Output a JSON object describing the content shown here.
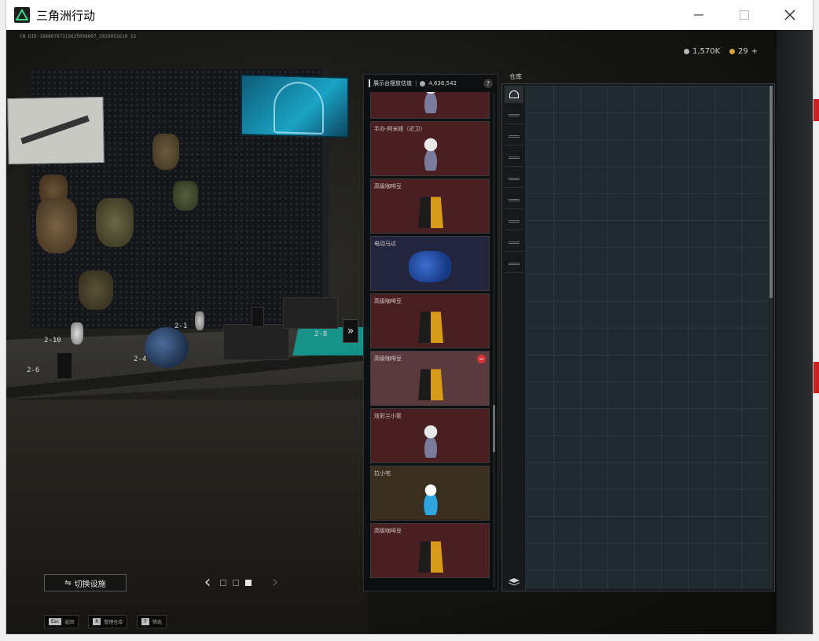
{
  "window": {
    "title": "三角洲行动",
    "controls": [
      "minimize",
      "maximize",
      "close"
    ]
  },
  "hud": {
    "uid_text": "CN UID:18880787315635098607_2026051610 15",
    "currency_1": "1,570K",
    "currency_2": "29",
    "currency_plus": "+"
  },
  "display_panel": {
    "title": "展示台摆放估值",
    "value": "4,636,542",
    "help": "?",
    "items": [
      {
        "name": "",
        "bg": "#4a1f22",
        "kind": "figure",
        "selected": false
      },
      {
        "name": "手办-阿米娅（近卫）",
        "bg": "#4a1f22",
        "kind": "figure",
        "selected": false
      },
      {
        "name": "高级咖啡豆",
        "bg": "#4a1f22",
        "kind": "bag",
        "selected": false
      },
      {
        "name": "电动马达",
        "bg": "#23253f",
        "kind": "motor",
        "selected": false
      },
      {
        "name": "高级咖啡豆",
        "bg": "#4a1f22",
        "kind": "bag",
        "selected": false
      },
      {
        "name": "高级咖啡豆",
        "bg": "#5a3a3d",
        "kind": "bag",
        "selected": true
      },
      {
        "name": "炫彩兰小筐",
        "bg": "#4a1f22",
        "kind": "figure",
        "selected": false
      },
      {
        "name": "拉小宅",
        "bg": "#3a2e1f",
        "kind": "figure-blue",
        "selected": false
      },
      {
        "name": "高级咖啡豆",
        "bg": "#4a1f22",
        "kind": "bag",
        "selected": false
      }
    ]
  },
  "warehouse": {
    "label": "仓库",
    "tab_count": 9
  },
  "bottom": {
    "switch_label": "切换设施",
    "hotkeys": [
      {
        "key": "Esc",
        "label": "返回"
      },
      {
        "key": "R",
        "label": "整理仓库"
      },
      {
        "key": "F",
        "label": "筛选"
      }
    ]
  },
  "scene": {
    "slots": [
      "2-10",
      "2-6",
      "2-1",
      "2-4",
      "2-8"
    ]
  }
}
